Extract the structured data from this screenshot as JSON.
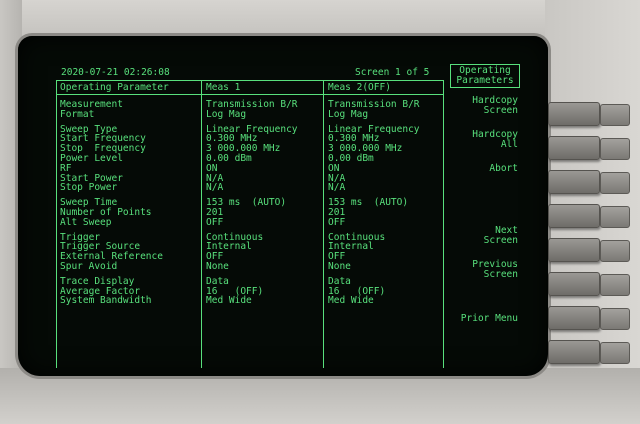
{
  "header": {
    "datetime": "2020-07-21 02:26:08",
    "screen_label": "Screen 1 of 5"
  },
  "table": {
    "columns": [
      "Operating Parameter",
      "Meas 1",
      "Meas 2(OFF)"
    ],
    "groups": [
      [
        [
          "Measurement",
          "Transmission B/R",
          "Transmission B/R"
        ],
        [
          "Format",
          "Log Mag",
          "Log Mag"
        ]
      ],
      [
        [
          "Sweep Type",
          "Linear Frequency",
          "Linear Frequency"
        ],
        [
          "Start Frequency",
          "0.300 MHz",
          "0.300 MHz"
        ],
        [
          "Stop  Frequency",
          "3 000.000 MHz",
          "3 000.000 MHz"
        ],
        [
          "Power Level",
          "0.00 dBm",
          "0.00 dBm"
        ],
        [
          "RF",
          "ON",
          "ON"
        ],
        [
          "Start Power",
          "N/A",
          "N/A"
        ],
        [
          "Stop Power",
          "N/A",
          "N/A"
        ]
      ],
      [
        [
          "Sweep Time",
          "153 ms  (AUTO)",
          "153 ms  (AUTO)"
        ],
        [
          "Number of Points",
          "201",
          "201"
        ],
        [
          "Alt Sweep",
          "OFF",
          "OFF"
        ]
      ],
      [
        [
          "Trigger",
          "Continuous",
          "Continuous"
        ],
        [
          "Trigger Source",
          "Internal",
          "Internal"
        ],
        [
          "External Reference",
          "OFF",
          "OFF"
        ],
        [
          "Spur Avoid",
          "None",
          "None"
        ]
      ],
      [
        [
          "Trace Display",
          "Data",
          "Data"
        ],
        [
          "Average Factor",
          "16   (OFF)",
          "16   (OFF)"
        ],
        [
          "System Bandwidth",
          "Med Wide",
          "Med Wide"
        ]
      ]
    ]
  },
  "softkeys": [
    {
      "lines": [
        "Operating",
        "Parameters"
      ],
      "boxed": true
    },
    {
      "lines": [
        "Hardcopy",
        "Screen"
      ],
      "boxed": false
    },
    {
      "lines": [
        "Hardcopy",
        "All"
      ],
      "boxed": false
    },
    {
      "lines": [
        "Abort"
      ],
      "boxed": false
    },
    {
      "lines": [
        "Next",
        "Screen"
      ],
      "boxed": false
    },
    {
      "lines": [
        "Previous",
        "Screen"
      ],
      "boxed": false
    },
    {
      "lines": [
        "Prior Menu"
      ],
      "boxed": false
    }
  ]
}
